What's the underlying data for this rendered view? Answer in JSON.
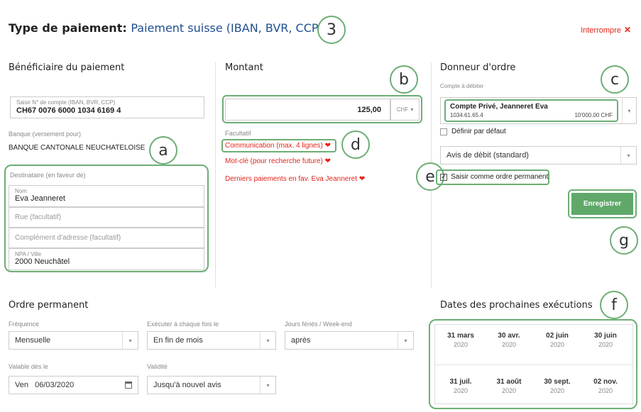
{
  "header": {
    "title_prefix": "Type de paiement:",
    "title_type": "Paiement suisse (IBAN, BVR, CCP)",
    "interrupt_label": "Interrompre",
    "interrupt_icon": "close-icon"
  },
  "annotations": {
    "n3": "3",
    "a": "a",
    "b": "b",
    "c": "c",
    "d": "d",
    "e": "e",
    "f": "f",
    "g": "g"
  },
  "beneficiary": {
    "section_title": "Bénéficiaire du paiement",
    "account_label": "Saisir N° de compte (IBAN, BVR, CCP)",
    "account_value": "CH67 0076 6000 1034 6169 4",
    "bank_label": "Banque (versement pour)",
    "bank_value": "BANQUE CANTONALE NEUCHATELOISE",
    "recipient_label": "Destinataire (en faveur de)",
    "name_label": "Nom",
    "name_value": "Eva Jeanneret",
    "street_placeholder": "Rue (facultatif)",
    "address_complement_placeholder": "Complément d'adresse (facultatif)",
    "zip_city_label": "NPA / Ville",
    "zip_city_value": "2000 Neuchâtel"
  },
  "amount": {
    "section_title": "Montant",
    "value": "125,00",
    "currency": "CHF",
    "optional_label": "Facultatif",
    "links": [
      "Communication (max. 4 lignes)",
      "Mot-clé (pour recherche future)",
      "Derniers paiements en fav. Eva Jeanneret"
    ]
  },
  "ordering_party": {
    "section_title": "Donneur d'ordre",
    "debit_account_label": "Compte à débiter",
    "account_name": "Compte Privé, Jeanneret Eva",
    "account_number": "1034.61.65.4",
    "account_balance": "10'000.00 CHF",
    "default_checkbox_label": "Définir par défaut",
    "default_checked": false,
    "debit_notice": "Avis de débit (standard)",
    "standing_order_label": "Saisir comme ordre permanent",
    "standing_order_checked": true,
    "save_label": "Enregistrer"
  },
  "standing_order": {
    "section_title": "Ordre permanent",
    "frequency_label": "Fréquence",
    "frequency_value": "Mensuelle",
    "execute_label": "Exécuter à chaque fois le",
    "execute_value": "En fin de mois",
    "holidays_label": "Jours fériés / Week-end",
    "holidays_value": "après",
    "valid_from_label": "Valable dès le",
    "valid_from_value": "Ven   06/03/2020",
    "validity_label": "Validité",
    "validity_value": "Jusqu'à nouvel avis"
  },
  "next_executions": {
    "section_title": "Dates des prochaines exécutions",
    "dates": [
      {
        "day": "31 mars",
        "year": "2020"
      },
      {
        "day": "30 avr.",
        "year": "2020"
      },
      {
        "day": "02 juin",
        "year": "2020"
      },
      {
        "day": "30 juin",
        "year": "2020"
      },
      {
        "day": "31 juil.",
        "year": "2020"
      },
      {
        "day": "31 août",
        "year": "2020"
      },
      {
        "day": "30 sept.",
        "year": "2020"
      },
      {
        "day": "02 nov.",
        "year": "2020"
      }
    ]
  },
  "colors": {
    "accent_green": "#5fa86a",
    "annotation_green": "#6cae75",
    "link_red": "#e3241b",
    "title_blue": "#1f4f8f"
  }
}
